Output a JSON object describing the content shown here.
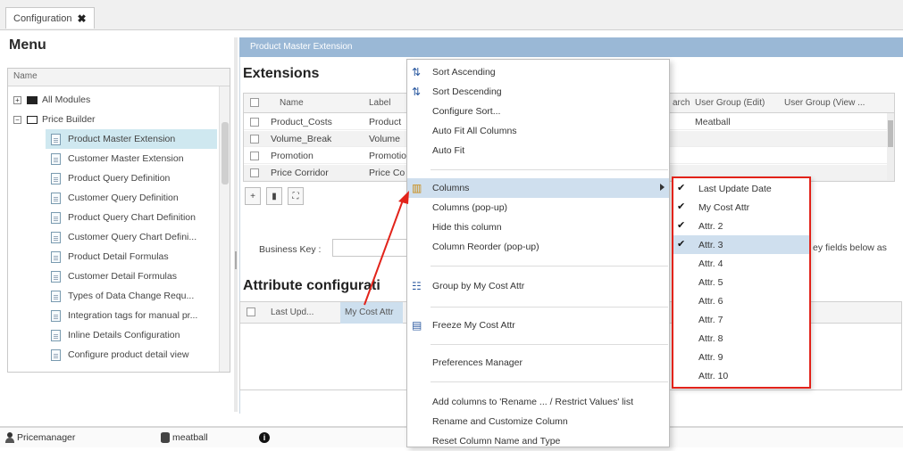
{
  "tab": {
    "label": "Configuration"
  },
  "menu": {
    "title": "Menu",
    "column_header": "Name",
    "items": [
      {
        "label": "All Modules",
        "level": 0,
        "state": "collapsed"
      },
      {
        "label": "Price Builder",
        "level": 0,
        "state": "expanded"
      },
      {
        "label": "Product Master Extension",
        "level": 1,
        "selected": true
      },
      {
        "label": "Customer Master Extension",
        "level": 1
      },
      {
        "label": "Product Query Definition",
        "level": 1
      },
      {
        "label": "Customer Query Definition",
        "level": 1
      },
      {
        "label": "Product Query Chart Definition",
        "level": 1
      },
      {
        "label": "Customer Query Chart Defini...",
        "level": 1
      },
      {
        "label": "Product Detail Formulas",
        "level": 1
      },
      {
        "label": "Customer Detail Formulas",
        "level": 1
      },
      {
        "label": "Types of Data Change Requ...",
        "level": 1
      },
      {
        "label": "Integration tags for manual pr...",
        "level": 1
      },
      {
        "label": "Inline Details Configuration",
        "level": 1
      },
      {
        "label": "Configure product detail view",
        "level": 1
      }
    ]
  },
  "panel": {
    "header": "Product Master Extension",
    "extensions_title": "Extensions",
    "grid_columns": [
      "Name",
      "Label",
      "arch",
      "User Group (Edit)",
      "User Group (View ..."
    ],
    "rows": [
      {
        "name": "Product_Costs",
        "label": "Product",
        "group_edit": "Meatball"
      },
      {
        "name": "Volume_Break",
        "label": "Volume",
        "group_edit": ""
      },
      {
        "name": "Promotion",
        "label": "Promotio",
        "group_edit": ""
      },
      {
        "name": "Price Corridor",
        "label": "Price Co",
        "group_edit": ""
      }
    ],
    "business_key_label": "Business Key :",
    "business_key_note": "ey fields below as",
    "attribute_title": "Attribute configurati",
    "attribute_columns": [
      "Last Upd...",
      "My Cost Attr"
    ]
  },
  "status_bar": {
    "user": "Pricemanager",
    "partition": "meatball"
  },
  "context_menu": {
    "items": [
      {
        "label": "Sort Ascending",
        "icon": "sort-ascending-icon"
      },
      {
        "label": "Sort Descending",
        "icon": "sort-descending-icon"
      },
      {
        "label": "Configure Sort..."
      },
      {
        "label": "Auto Fit All Columns"
      },
      {
        "label": "Auto Fit"
      },
      {
        "label": "Columns",
        "icon": "columns-icon",
        "submenu": true,
        "highlighted": true
      },
      {
        "label": "Columns (pop-up)"
      },
      {
        "label": "Hide this column"
      },
      {
        "label": "Column Reorder (pop-up)"
      },
      {
        "label": "Group by My Cost Attr",
        "icon": "group-icon"
      },
      {
        "label": "Freeze My Cost Attr",
        "icon": "freeze-icon"
      },
      {
        "label": "Preferences Manager"
      },
      {
        "label": "Add columns to 'Rename ... / Restrict Values' list"
      },
      {
        "label": "Rename and Customize Column"
      },
      {
        "label": "Reset Column Name and Type"
      }
    ]
  },
  "columns_submenu": {
    "highlight_color": "#e2231a",
    "items": [
      {
        "label": "Last Update Date",
        "checked": true
      },
      {
        "label": "My Cost Attr",
        "checked": true
      },
      {
        "label": "Attr. 2",
        "checked": true
      },
      {
        "label": "Attr. 3",
        "checked": true,
        "highlighted": true
      },
      {
        "label": "Attr. 4",
        "checked": false
      },
      {
        "label": "Attr. 5",
        "checked": false
      },
      {
        "label": "Attr. 6",
        "checked": false
      },
      {
        "label": "Attr. 7",
        "checked": false
      },
      {
        "label": "Attr. 8",
        "checked": false
      },
      {
        "label": "Attr. 9",
        "checked": false
      },
      {
        "label": "Attr. 10",
        "checked": false
      }
    ]
  }
}
